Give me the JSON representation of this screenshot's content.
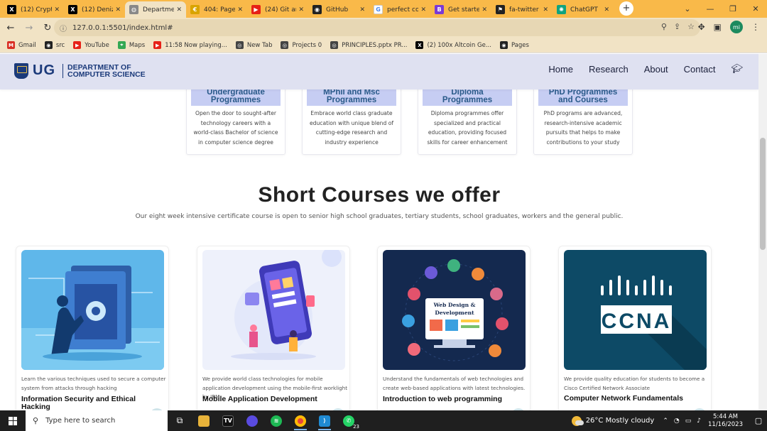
{
  "browser": {
    "tabs": [
      {
        "title": "(12) Crypto",
        "icon": "x-icon",
        "color": "#000000",
        "glyph": "X"
      },
      {
        "title": "(12) Deniz",
        "icon": "x-icon",
        "color": "#000000",
        "glyph": "X"
      },
      {
        "title": "Departmen",
        "icon": "globe-icon",
        "color": "#888888",
        "glyph": "◍",
        "active": true
      },
      {
        "title": "404: Page",
        "icon": "coin-icon",
        "color": "#d9a400",
        "glyph": "€"
      },
      {
        "title": "(24) Git an",
        "icon": "youtube-icon",
        "color": "#e62117",
        "glyph": "▶"
      },
      {
        "title": "GitHub",
        "icon": "github-icon",
        "color": "#222222",
        "glyph": "◉"
      },
      {
        "title": "perfect co",
        "icon": "google-icon",
        "color": "#ffffff",
        "glyph": "G"
      },
      {
        "title": "Get starte",
        "icon": "bootstrap-icon",
        "color": "#7a3ad6",
        "glyph": "B"
      },
      {
        "title": "fa-twitter",
        "icon": "fa-icon",
        "color": "#222222",
        "glyph": "⚑"
      },
      {
        "title": "ChatGPT",
        "icon": "chatgpt-icon",
        "color": "#10a37f",
        "glyph": "✺"
      }
    ],
    "window_controls": [
      "⌄",
      "—",
      "❐",
      "✕"
    ],
    "url": "127.0.0.1:5501/index.html#",
    "bookmarks": [
      {
        "label": "Gmail",
        "icon": "gmail-icon",
        "color": "#d93025",
        "glyph": "M"
      },
      {
        "label": "src",
        "icon": "github-icon",
        "color": "#222222",
        "glyph": "◉"
      },
      {
        "label": "YouTube",
        "icon": "youtube-icon",
        "color": "#e62117",
        "glyph": "▶"
      },
      {
        "label": "Maps",
        "icon": "maps-icon",
        "color": "#34a853",
        "glyph": "⌖"
      },
      {
        "label": "11:58 Now playing...",
        "icon": "youtube-icon",
        "color": "#e62117",
        "glyph": "▶"
      },
      {
        "label": "New Tab",
        "icon": "chrome-icon",
        "color": "#444444",
        "glyph": "◎"
      },
      {
        "label": "Projects 0",
        "icon": "chrome-icon",
        "color": "#444444",
        "glyph": "◎"
      },
      {
        "label": "PRINCIPLES.pptx PR...",
        "icon": "chrome-icon",
        "color": "#444444",
        "glyph": "◎"
      },
      {
        "label": "(2) 100x Altcoin Ge...",
        "icon": "x-icon",
        "color": "#000000",
        "glyph": "X"
      },
      {
        "label": "Pages",
        "icon": "github-icon",
        "color": "#222222",
        "glyph": "◉"
      }
    ]
  },
  "site": {
    "logo_ug": "UG",
    "logo_dept_line1": "DEPARTMENT OF",
    "logo_dept_line2": "COMPUTER SCIENCE",
    "nav": [
      "Home",
      "Research",
      "About",
      "Contact"
    ],
    "programmes": [
      {
        "title1": "Undergraduate",
        "title2": "Programmes",
        "desc": "Open the door to sought-after technology careers with a world-class Bachelor of science in computer science degree"
      },
      {
        "title1": "MPhil and Msc",
        "title2": "Programmes",
        "desc": "Embrace world class graduate education with unique blend of cutting-edge research and industry experience"
      },
      {
        "title1": "Diploma",
        "title2": "Programmes",
        "desc": "Diploma programmes offer specialized and practical education, providing focused skills for career enhancement"
      },
      {
        "title1": "PhD Programmes",
        "title2": "and Courses",
        "desc": "PhD programs are advanced, research-intensive academic pursuits that helps to make contributions to your study"
      }
    ],
    "short_courses_title": "Short Courses we offer",
    "short_courses_subtitle": "Our eight week intensive certificate course is open to senior high school graduates, tertiary students, school graduates, workers and the general public.",
    "courses": [
      {
        "desc": "Learn the various techniques used to secure a computer system from attacks through hacking",
        "title": "Information Security and Ethical Hacking"
      },
      {
        "desc": "We provide world class technologies for mobile application development using the mobile-first worklight by IBM",
        "title": "Mobile Application Development"
      },
      {
        "desc": "Understand the fundamentals of web technologies and create web-based applications with latest technologies.",
        "title": "Introduction to web programming"
      },
      {
        "desc": "We provide quality education for students to become a Cisco Certified Network Associate",
        "title": "Computer Network Fundamentals"
      }
    ],
    "web_design_label1": "Web Design &",
    "web_design_label2": "Development",
    "ccna_label": "CCNA"
  },
  "taskbar": {
    "search_placeholder": "Type here to search",
    "weather": "26°C  Mostly cloudy",
    "time": "5:44 AM",
    "date": "11/16/2023",
    "badge": "23"
  }
}
